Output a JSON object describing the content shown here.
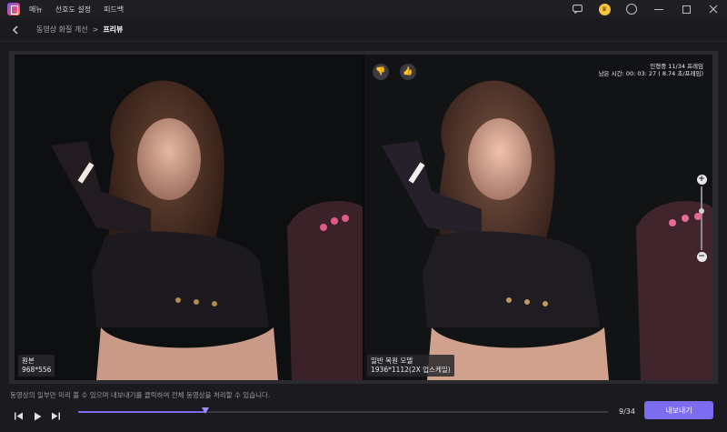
{
  "titlebar": {
    "menu": [
      "메뉴",
      "선호도 설정",
      "피드백"
    ],
    "icons": [
      "chat-icon",
      "crown-icon",
      "user-icon",
      "minimize-icon",
      "maximize-icon",
      "close-icon"
    ]
  },
  "navbar": {
    "breadcrumb_parent": "동영상 화질 개선",
    "breadcrumb_sep": ">",
    "breadcrumb_current": "프리뷰"
  },
  "preview": {
    "left_label": "원본",
    "left_resolution": "968*556",
    "right_label": "일반 복원 모델",
    "right_resolution": "1936*1112(2X 업스케일)",
    "info_line1": "인형중 11/34 프레임",
    "info_line2": "남은 시간: 00: 03: 27 ( 8.74 초/프레임)",
    "zoom_level": 0.62
  },
  "notice": "동영상의 일부만 미리 볼 수 있으며 내보내기를 클릭하여 전체 동영상을 처리할 수 있습니다.",
  "player": {
    "frame_counter": "9/34",
    "progress": 0.24,
    "export_label": "내보내기"
  },
  "colors": {
    "accent": "#7b6cf0",
    "background": "#1b1b1f"
  }
}
